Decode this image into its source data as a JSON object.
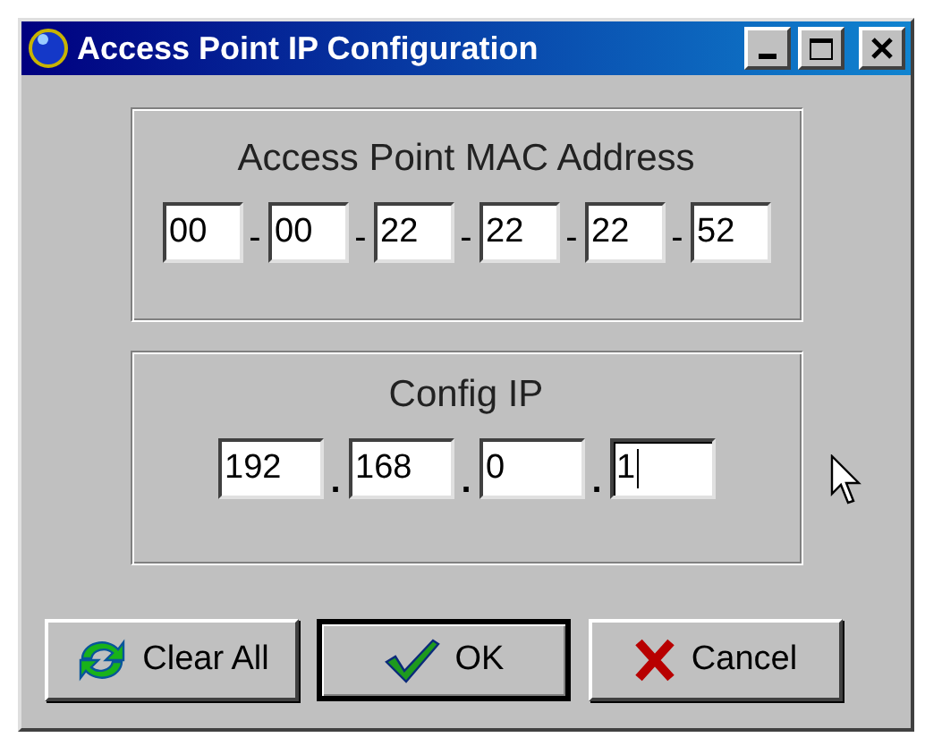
{
  "window": {
    "title": "Access Point IP Configuration",
    "controls": [
      {
        "kind": "minimize"
      },
      {
        "kind": "maximize"
      },
      {
        "kind": "close"
      }
    ]
  },
  "groups": [
    {
      "title": "Access Point MAC Address",
      "kind": "mac",
      "fields": [
        {
          "value": "00",
          "focused": false
        },
        {
          "separator": "-",
          "value": "00",
          "focused": false
        },
        {
          "separator": "-",
          "value": "22",
          "focused": false
        },
        {
          "separator": "-",
          "value": "22",
          "focused": false
        },
        {
          "separator": "-",
          "value": "22",
          "focused": false
        },
        {
          "separator": "-",
          "value": "52",
          "focused": false
        }
      ]
    },
    {
      "title": "Config IP",
      "kind": "ip",
      "fields": [
        {
          "value": "192",
          "focused": false
        },
        {
          "separator": ".",
          "value": "168",
          "focused": false
        },
        {
          "separator": ".",
          "value": "0",
          "focused": false
        },
        {
          "separator": ".",
          "value": "1",
          "focused": true
        }
      ]
    }
  ],
  "buttons": [
    {
      "label": "Clear All",
      "kind": "refresh",
      "default": false
    },
    {
      "label": "OK",
      "kind": "confirm",
      "default": true
    },
    {
      "label": "Cancel",
      "kind": "cancel",
      "default": false
    }
  ]
}
